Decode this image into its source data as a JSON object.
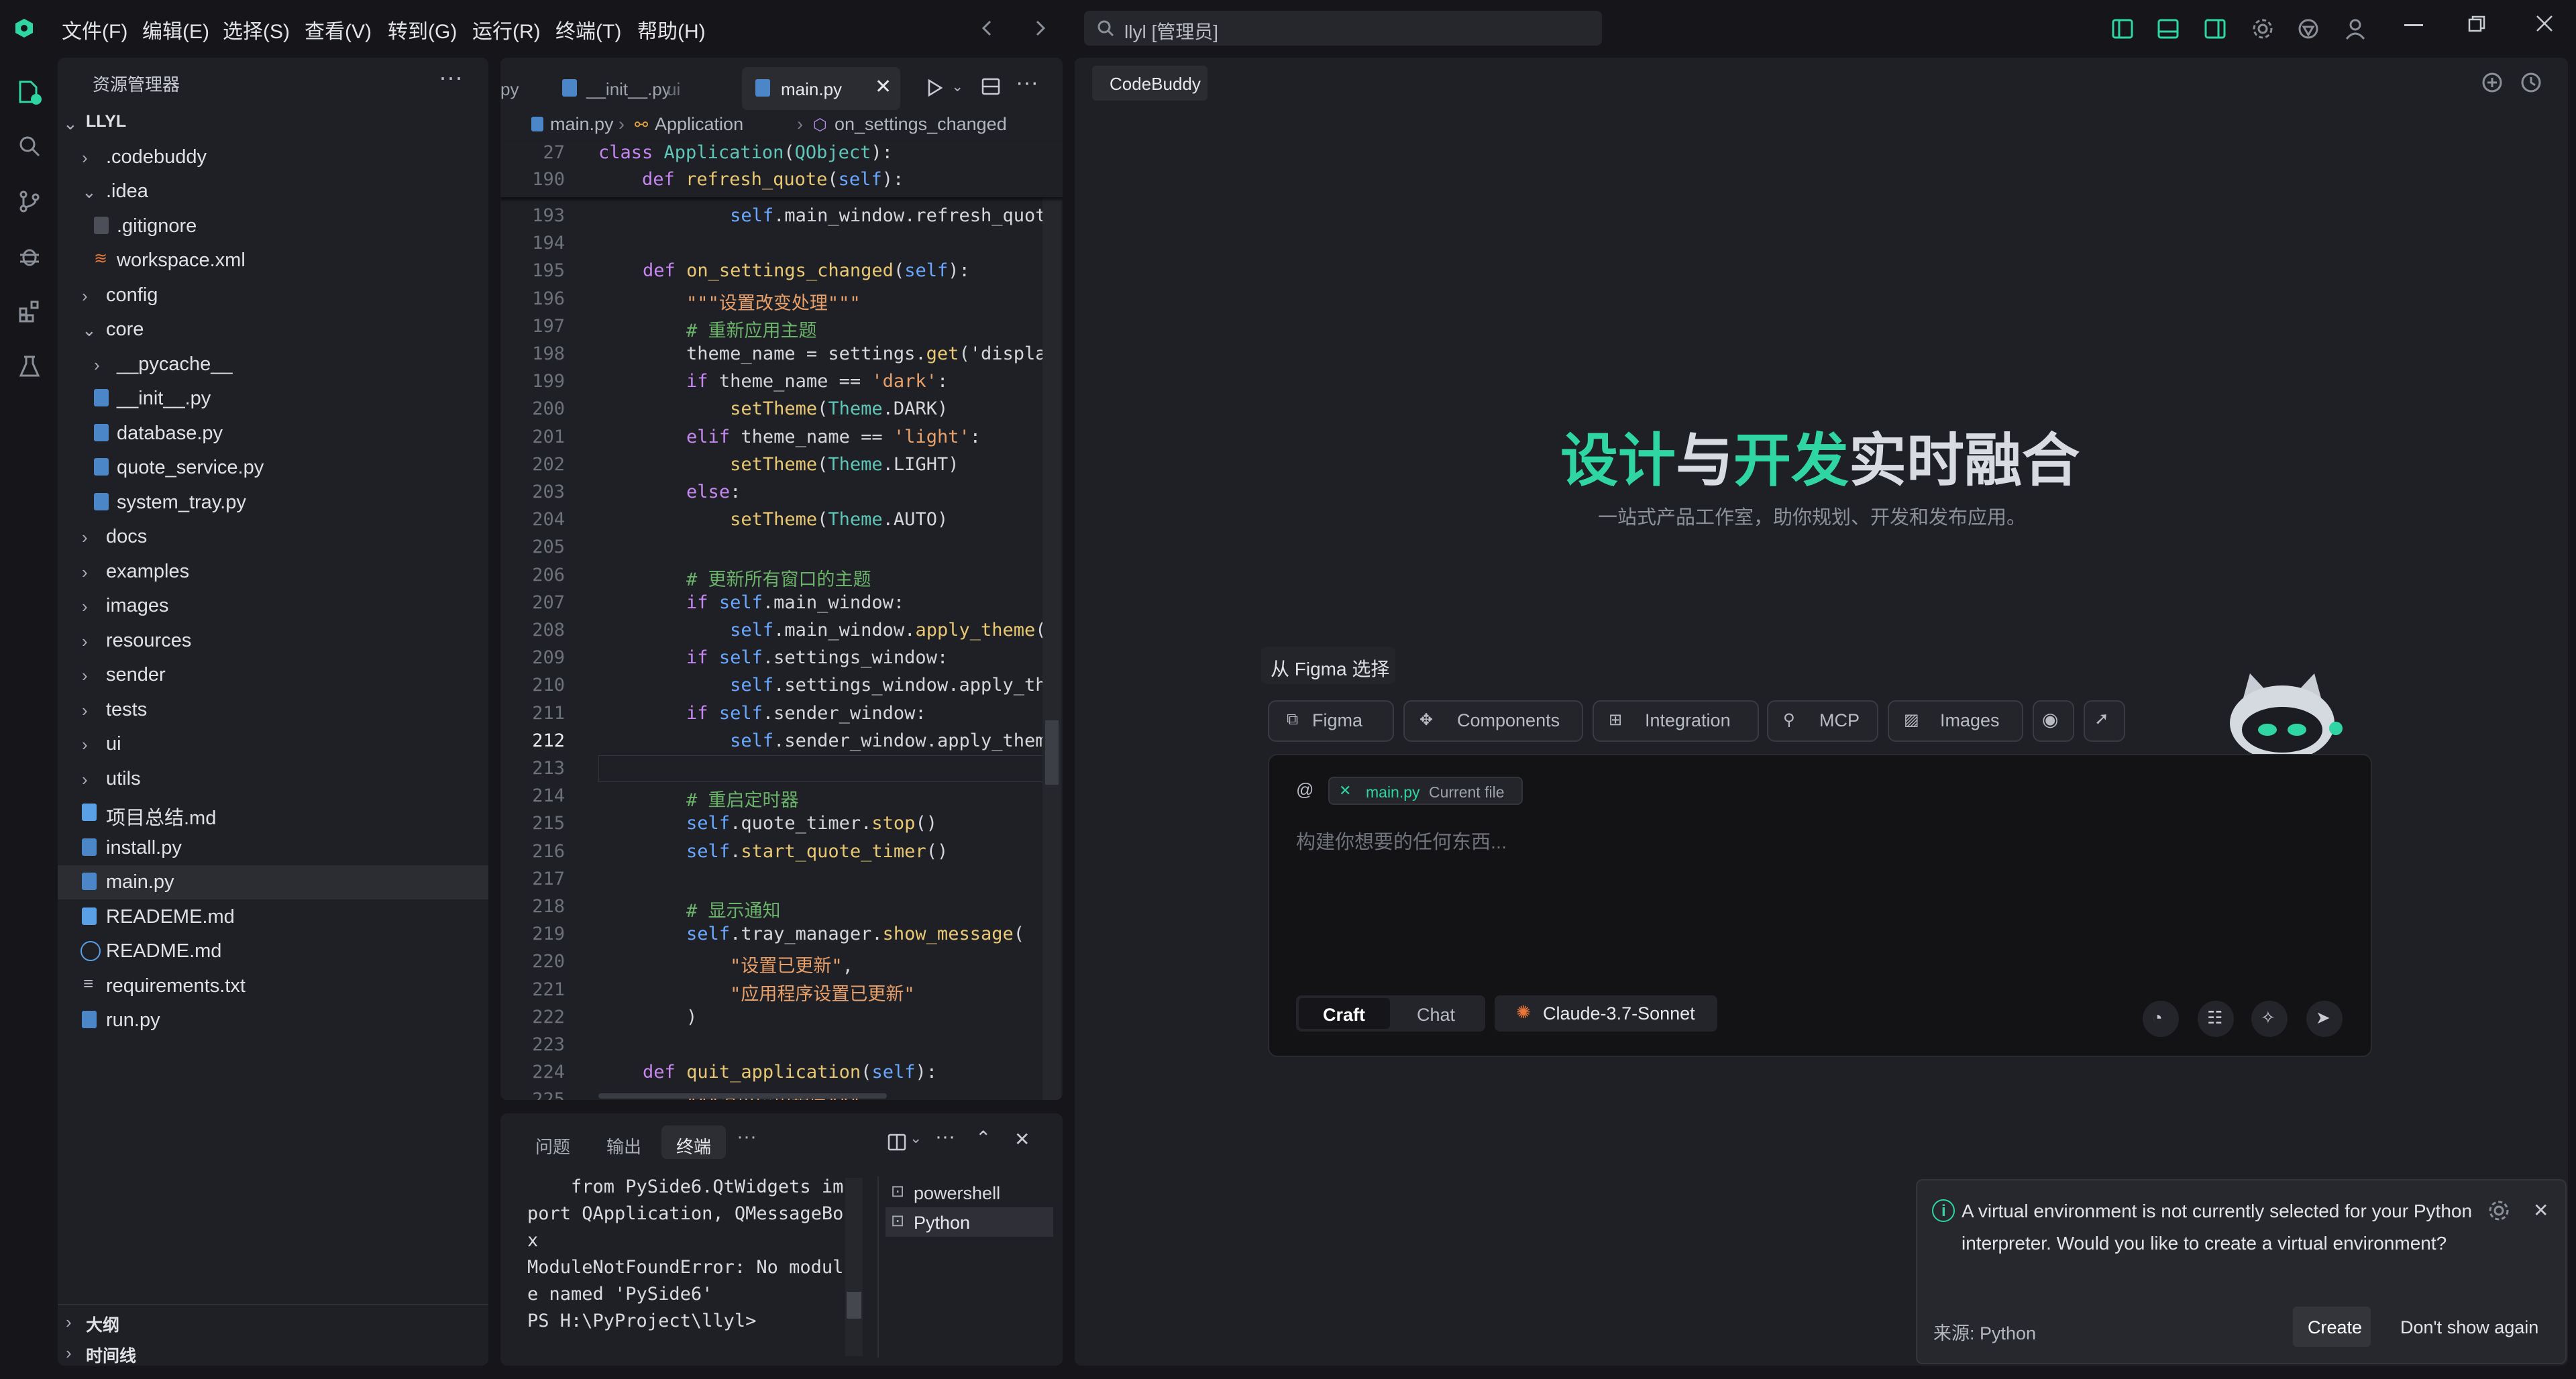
{
  "menu": [
    "文件(F)",
    "编辑(E)",
    "选择(S)",
    "查看(V)",
    "转到(G)",
    "运行(R)",
    "终端(T)",
    "帮助(H)"
  ],
  "search": {
    "text": "llyl [管理员]"
  },
  "explorer": {
    "title": "资源管理器",
    "root": "LLYL",
    "items": [
      ".codebuddy",
      ".idea",
      ".gitignore",
      "workspace.xml",
      "config",
      "core",
      "__pycache__",
      "__init__.py",
      "database.py",
      "quote_service.py",
      "system_tray.py",
      "docs",
      "examples",
      "images",
      "resources",
      "sender",
      "tests",
      "ui",
      "utils",
      "项目总结.md",
      "install.py",
      "main.py",
      "READEME.md",
      "README.md",
      "requirements.txt",
      "run.py"
    ],
    "bottom": [
      "大纲",
      "时间线"
    ]
  },
  "editor": {
    "tabs": [
      "py",
      "__init__.py",
      "ui",
      "main.py"
    ],
    "breadcrumb": [
      "main.py",
      "Application",
      "on_settings_changed"
    ],
    "sticky": [
      {
        "ln": "27",
        "code": "class Application(QObject):"
      },
      {
        "ln": "190",
        "code": "    def refresh_quote(self):"
      }
    ],
    "lines": [
      {
        "ln": "193",
        "code": "            self.main_window.refresh_quote"
      },
      {
        "ln": "194",
        "code": ""
      },
      {
        "ln": "195",
        "code": "    def on_settings_changed(self):"
      },
      {
        "ln": "196",
        "code": "        \"\"\"设置改变处理\"\"\""
      },
      {
        "ln": "197",
        "code": "        # 重新应用主题"
      },
      {
        "ln": "198",
        "code": "        theme_name = settings.get('display"
      },
      {
        "ln": "199",
        "code": "        if theme_name == 'dark':"
      },
      {
        "ln": "200",
        "code": "            setTheme(Theme.DARK)"
      },
      {
        "ln": "201",
        "code": "        elif theme_name == 'light':"
      },
      {
        "ln": "202",
        "code": "            setTheme(Theme.LIGHT)"
      },
      {
        "ln": "203",
        "code": "        else:"
      },
      {
        "ln": "204",
        "code": "            setTheme(Theme.AUTO)"
      },
      {
        "ln": "205",
        "code": ""
      },
      {
        "ln": "206",
        "code": "        # 更新所有窗口的主题"
      },
      {
        "ln": "207",
        "code": "        if self.main_window:"
      },
      {
        "ln": "208",
        "code": "            self.main_window.apply_theme()"
      },
      {
        "ln": "209",
        "code": "        if self.settings_window:"
      },
      {
        "ln": "210",
        "code": "            self.settings_window.apply_the"
      },
      {
        "ln": "211",
        "code": "        if self.sender_window:"
      },
      {
        "ln": "212",
        "code": "            self.sender_window.apply_theme"
      },
      {
        "ln": "213",
        "code": ""
      },
      {
        "ln": "214",
        "code": "        # 重启定时器"
      },
      {
        "ln": "215",
        "code": "        self.quote_timer.stop()"
      },
      {
        "ln": "216",
        "code": "        self.start_quote_timer()"
      },
      {
        "ln": "217",
        "code": ""
      },
      {
        "ln": "218",
        "code": "        # 显示通知"
      },
      {
        "ln": "219",
        "code": "        self.tray_manager.show_message("
      },
      {
        "ln": "220",
        "code": "            \"设置已更新\","
      },
      {
        "ln": "221",
        "code": "            \"应用程序设置已更新\""
      },
      {
        "ln": "222",
        "code": "        )"
      },
      {
        "ln": "223",
        "code": ""
      },
      {
        "ln": "224",
        "code": "    def quit_application(self):"
      },
      {
        "ln": "225",
        "code": "        \"\"\"退出应用程序\"\"\""
      }
    ]
  },
  "terminal": {
    "tabs": [
      "问题",
      "输出",
      "终端"
    ],
    "lines": [
      "    from PySide6.QtWidgets im",
      "port QApplication, QMessageBo",
      "x",
      "ModuleNotFoundError: No modul",
      "e named 'PySide6'",
      "PS H:\\PyProject\\llyl>"
    ],
    "sessions": [
      "powershell",
      "Python"
    ]
  },
  "codebuddy": {
    "tab": "CodeBuddy",
    "hero_a": "设计",
    "hero_b": "与",
    "hero_c": "开发",
    "hero_d": "实时融合",
    "subtitle": "一站式产品工作室，助你规划、开发和发布应用。",
    "figma_select": "从 Figma 选择",
    "chips": [
      "Figma",
      "Components",
      "Integration",
      "MCP",
      "Images"
    ],
    "file_chip": "main.py",
    "file_chip_note": "Current file",
    "placeholder": "构建你想要的任何东西...",
    "modes": [
      "Craft",
      "Chat"
    ],
    "model": "Claude-3.7-Sonnet"
  },
  "notification": {
    "message_1": "A virtual environment is not currently selected for your Python",
    "message_2": "interpreter. Would you like to create a virtual environment?",
    "source": "来源: Python",
    "create": "Create",
    "dismiss": "Don't show again"
  },
  "colors": {
    "accent": "#2fd6a3",
    "bg": "#16161a",
    "panel": "#1f2025"
  }
}
